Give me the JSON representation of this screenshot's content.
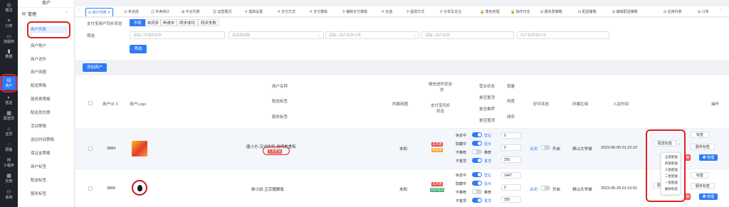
{
  "rail": [
    {
      "icon": "◎",
      "label": "概况"
    },
    {
      "icon": "≡",
      "label": "订单"
    },
    {
      "icon": "▭",
      "label": "加盟商"
    },
    {
      "icon": "▮",
      "label": "数据"
    },
    {
      "icon": "⊟",
      "label": "商户"
    },
    {
      "icon": "◐",
      "label": "售后"
    },
    {
      "icon": "▦",
      "label": "配送员"
    },
    {
      "icon": "⌂",
      "label": "店员"
    },
    {
      "icon": "◌",
      "label": "顾客"
    },
    {
      "icon": "✉",
      "label": "小程序"
    },
    {
      "icon": "▦",
      "label": "应用"
    },
    {
      "icon": "⚇",
      "label": "系统"
    }
  ],
  "sub": {
    "title": "商户",
    "group": "管理",
    "items": [
      "商户列表",
      "商户账户",
      "商户进件",
      "商户商圈",
      "配送策略",
      "服务费策略",
      "配送员优惠",
      "活动策略",
      "送达时间策略",
      "保证金策略",
      "商户标签",
      "配送标签",
      "服务标签"
    ]
  },
  "tabs": [
    "商户列表",
    "未完成",
    "外卖统计",
    "平台列表",
    "运营概况",
    "基础设置",
    "支付方式",
    "支付模板",
    "编辑支付模板",
    "充值",
    "提现方式",
    "分享及关注",
    "角色管理",
    "操作日志",
    "服务费策略",
    "配送策略",
    "编辑配送策略",
    "应用列表",
    "订单"
  ],
  "filter": {
    "sync_label": "支付宝商户同步状态",
    "sync_options": [
      "不限",
      "未同步",
      "申请中",
      "同步成功",
      "同步失败"
    ],
    "search_label": "筛选",
    "agent_placeholder": "请输入代理商名称",
    "area_placeholder": "请选择商圈",
    "category_placeholder": "请输入商户名称分类",
    "merchant_placeholder": "请输入商户名称",
    "id_placeholder": "商户名称/商户ID",
    "filter_button": "筛选",
    "add_button": "添加商户"
  },
  "headers": {
    "id": "商户ID",
    "logo": "商户Logo",
    "name_1": "商户名称",
    "name_2": "配送标签",
    "name_3": "服务标签",
    "area": "所属商圈",
    "wechat_1": "微信进件状态",
    "wechat_2": "态",
    "alipay_1": "支付宝同步",
    "alipay_2": "状态",
    "biz_1": "营业状态",
    "biz_2": "是否置顶",
    "biz_3": "是否推荐",
    "biz_4": "是否置顶",
    "sales": "销量",
    "heat": "热度",
    "sort": "排序",
    "praise": "好评状态",
    "school": "所属区域",
    "time": "入驻时间",
    "action": "操作"
  },
  "rows": [
    {
      "id": "3884",
      "name": "唐小方·汉式炸鸡·烧烤美食街",
      "tag": "五星配送",
      "area": "未知",
      "wechat_a": "未开通",
      "wechat_b": "审核中",
      "status_labels": [
        "休息中",
        "隐藏中",
        "不推荐",
        "不置顶"
      ],
      "status_values": [
        "营业",
        "显示",
        "推荐",
        "置顶"
      ],
      "numbers": [
        "0",
        "0",
        "255"
      ],
      "praise": "关闭",
      "praise_on": "开启",
      "school": "狮山大学城",
      "time": "2023-06-05 01:22:22",
      "btn_dispatch": "配送标签",
      "btn_more": "标签",
      "btn_service": "服务标签",
      "btn_del": "删",
      "btn_manage": "✿ 管理"
    },
    {
      "id": "3866",
      "name": "新小田·正宗猪脚饭",
      "tag": "",
      "area": "未知",
      "wechat_a": "未开通",
      "wechat_b": "同步成功",
      "status_labels": [
        "休息中",
        "隐藏中",
        "不推荐",
        "不置顶"
      ],
      "status_values": [
        "营业",
        "显示",
        "推荐",
        "置顶"
      ],
      "numbers": [
        "1447",
        "0",
        "255"
      ],
      "praise": "关闭",
      "praise_on": "开启",
      "school": "狮山大学城",
      "time": "2023-05-29 01:15:01",
      "btn_dispatch": "配送",
      "btn_more": "标签",
      "btn_service": "服务标签",
      "btn_del": "删",
      "btn_manage": "✿ 管理"
    }
  ],
  "dropdown": [
    "五星配送",
    "四星配送",
    "三星配送",
    "二星配送",
    "一星配送",
    "删除标签"
  ],
  "colors": {
    "accent": "#2f7bf5",
    "highlight": "#e02020",
    "rail": "#1f2229"
  }
}
